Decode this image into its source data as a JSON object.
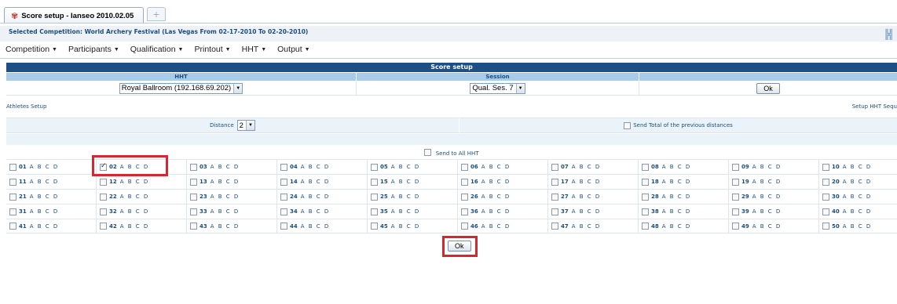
{
  "tab": {
    "title": "Score setup - Ianseo 2010.02.05",
    "new_tab": "+"
  },
  "header": {
    "competition": "Selected Competition: World Archery Festival (Las Vegas From 02-17-2010 To 02-20-2010)",
    "logo_icon": "ianseo-logo-icon"
  },
  "menu": {
    "items": [
      "Competition",
      "Participants",
      "Qualification",
      "Printout",
      "HHT",
      "Output"
    ]
  },
  "score_setup": {
    "title": "Score setup",
    "col_hht": "HHT",
    "col_session": "Session",
    "hht_value": "Royal Ballroom (192.168.69.202)",
    "session_value": "Qual. Ses. 7",
    "ok_label": "Ok"
  },
  "links": {
    "athletes_setup": "Athletes Setup",
    "setup_hht_seq": "Setup HHT Sequ"
  },
  "distance": {
    "label": "Distance",
    "value": "2",
    "send_total": "Send Total of the previous distances"
  },
  "send_all": "Send to All HHT",
  "targets": [
    [
      "01",
      "02",
      "03",
      "04",
      "05",
      "06",
      "07",
      "08",
      "09",
      "10"
    ],
    [
      "11",
      "12",
      "13",
      "14",
      "15",
      "16",
      "17",
      "18",
      "19",
      "20"
    ],
    [
      "21",
      "22",
      "23",
      "24",
      "25",
      "26",
      "27",
      "28",
      "29",
      "30"
    ],
    [
      "31",
      "32",
      "33",
      "34",
      "35",
      "36",
      "37",
      "38",
      "39",
      "40"
    ],
    [
      "41",
      "42",
      "43",
      "44",
      "45",
      "46",
      "47",
      "48",
      "49",
      "50"
    ]
  ],
  "target_letters": "A B C D",
  "checked_targets": [
    "02"
  ],
  "ok_bottom": "Ok",
  "highlight_color": "#d7262e"
}
